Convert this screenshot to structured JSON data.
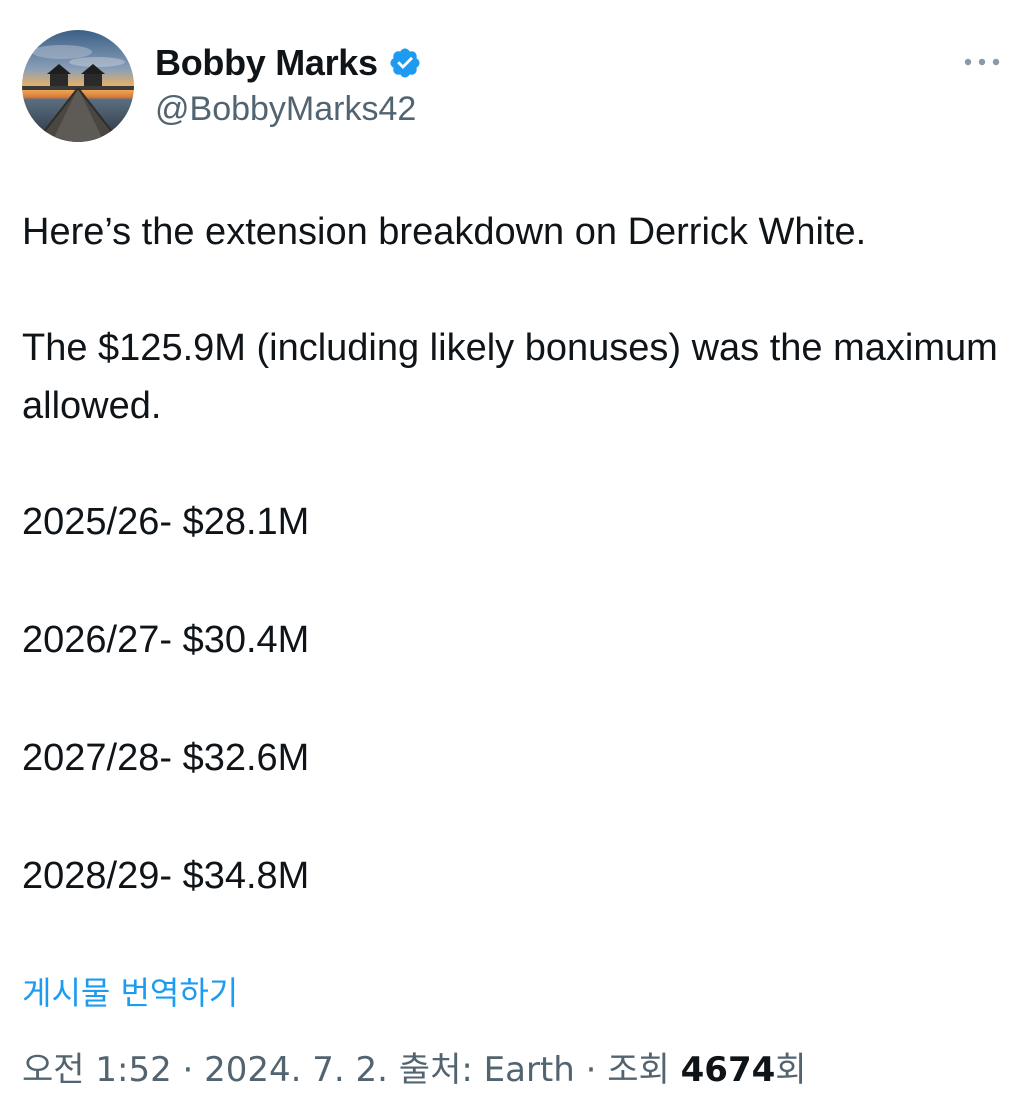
{
  "author": {
    "display_name": "Bobby Marks",
    "handle": "@BobbyMarks42",
    "verified": true,
    "avatar_icon": "pier-sunset-photo"
  },
  "menu": {
    "icon": "more-horizontal-icon"
  },
  "tweet": {
    "line1": "Here’s the extension breakdown on Derrick White.",
    "line2": "The $125.9M (including likely bonuses) was the maximum allowed.",
    "years": [
      "2025/26- $28.1M",
      "2026/27- $30.4M",
      "2027/28- $32.6M",
      "2028/29- $34.8M"
    ]
  },
  "translate_label": "게시물 번역하기",
  "meta": {
    "time": "오전 1:52",
    "sep1": " · ",
    "date": "2024. 7. 2.",
    "source_prefix": " 출처: ",
    "source": "Earth",
    "sep2": " · ",
    "views_prefix": "조회 ",
    "views_count": "4674",
    "views_suffix": "회"
  },
  "colors": {
    "text": "#0f1419",
    "secondary": "#536471",
    "accent": "#1d9bf0",
    "verified": "#1d9bf0"
  }
}
